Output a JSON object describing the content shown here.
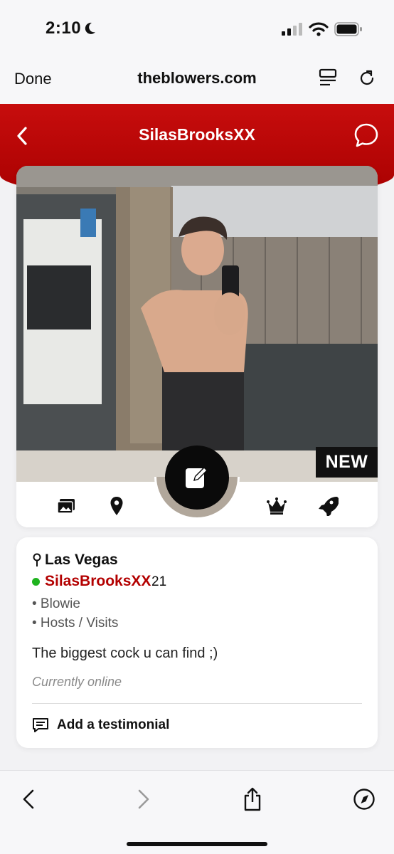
{
  "status_bar": {
    "time": "2:10"
  },
  "browser": {
    "done_label": "Done",
    "url": "theblowers.com"
  },
  "profile_header": {
    "title": "SilasBrooksXX"
  },
  "photo": {
    "badge": "NEW"
  },
  "icons": [
    "photos-icon",
    "location-pin-icon",
    "edit-icon",
    "crown-icon",
    "rocket-icon"
  ],
  "profile": {
    "city": "Las Vegas",
    "username": "SilasBrooksXX",
    "age": "21",
    "tags": [
      "• Blowie",
      "• Hosts / Visits"
    ],
    "bio": "The biggest cock u can find ;)",
    "status": "Currently online",
    "testimonial_label": "Add a testimonial"
  },
  "colors": {
    "brand_red": "#b30000",
    "online_green": "#1fb31f",
    "header_red": "#c70d0d"
  }
}
